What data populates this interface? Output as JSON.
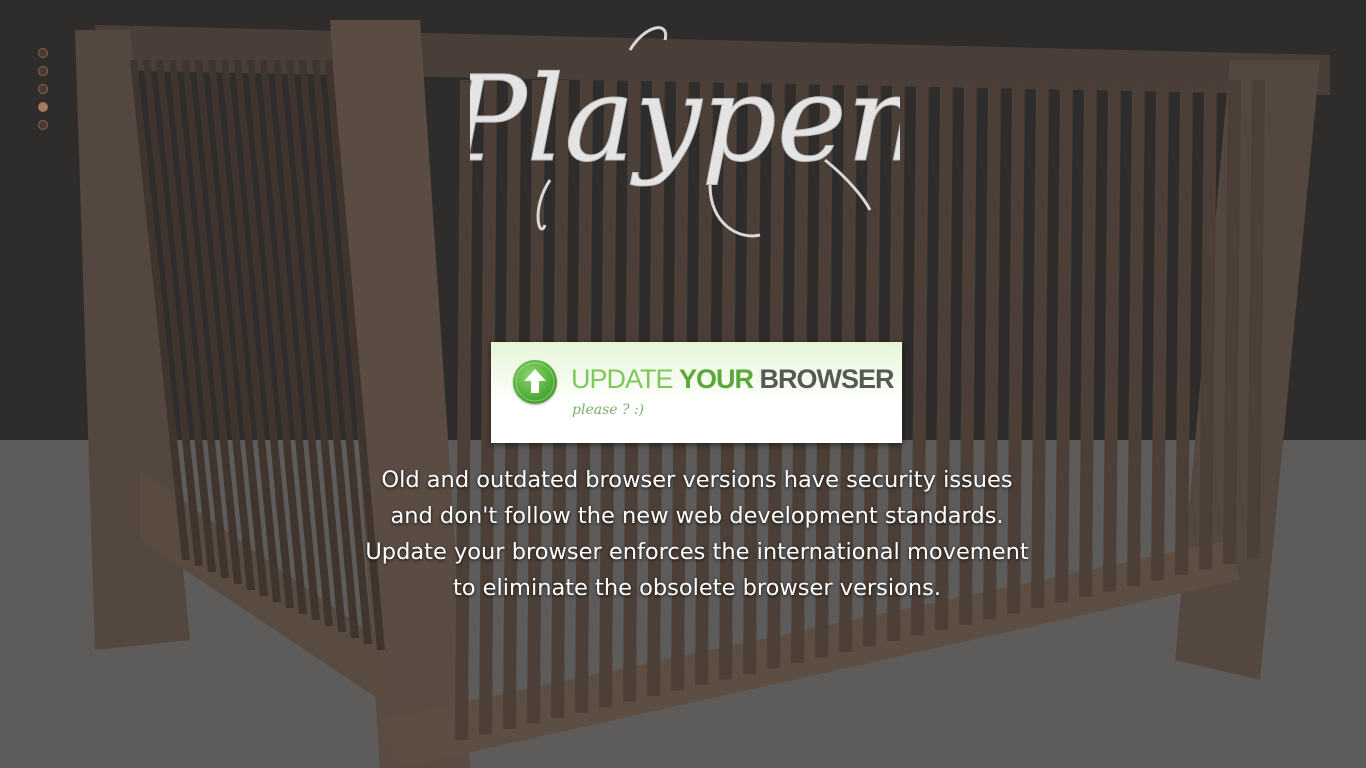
{
  "brand": {
    "logo_text": "Playpen"
  },
  "nav": {
    "dots": [
      {
        "active": false
      },
      {
        "active": false
      },
      {
        "active": false
      },
      {
        "active": true
      },
      {
        "active": false
      }
    ]
  },
  "update_banner": {
    "title_part1": "UPDATE ",
    "title_part2": "YOUR ",
    "title_part3": "BROWSER",
    "subtitle": "please ? :)",
    "icon": "up-arrow-icon"
  },
  "message": {
    "lines": [
      "Old and outdated browser versions have security issues",
      "and don't follow the new web development standards.",
      "Update your browser enforces the international movement",
      "to eliminate the obsolete browser versions."
    ]
  },
  "colors": {
    "accent_green": "#5aa83a",
    "light_green": "#7cc95a",
    "dark_text": "#555a55",
    "logo_white": "#e8e8e8"
  }
}
